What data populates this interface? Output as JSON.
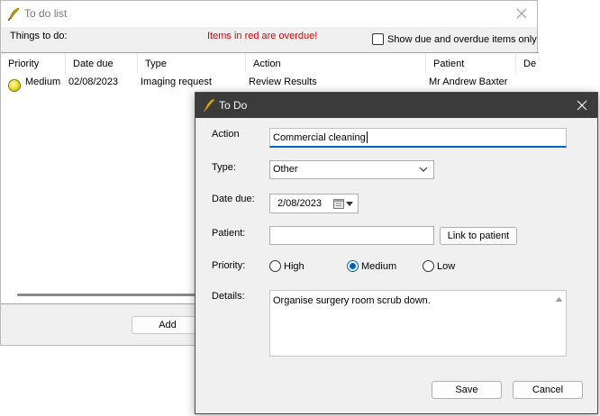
{
  "bg_window": {
    "title": "To do list",
    "things_label": "Things to do:",
    "overdue_note": "Items in red are overdue!",
    "show_due_label": "Show due and overdue items only",
    "columns": [
      "Priority",
      "Date due",
      "Type",
      "Action",
      "Patient",
      "De"
    ],
    "rows": [
      {
        "priority": "Medium",
        "date_due": "02/08/2023",
        "type": "Imaging request",
        "action": "Review Results",
        "patient": "Mr Andrew Baxter"
      }
    ],
    "add_label": "Add"
  },
  "dialog": {
    "title": "To Do",
    "action_label": "Action",
    "action_value": "Commercial cleaning",
    "type_label": "Type:",
    "type_value": "Other",
    "date_label": "Date due:",
    "date_value": "2/08/2023",
    "patient_label": "Patient:",
    "patient_value": "",
    "link_patient_label": "Link to patient",
    "priority_label": "Priority:",
    "priority_options": [
      "High",
      "Medium",
      "Low"
    ],
    "priority_selected": "Medium",
    "details_label": "Details:",
    "details_value": "Organise surgery room scrub down.",
    "save_label": "Save",
    "cancel_label": "Cancel"
  },
  "colors": {
    "overdue_red": "#e00000",
    "focus_blue": "#0067c0",
    "dialog_titlebar": "#3b3b3b",
    "priority_medium": "#f2e23a"
  },
  "icons": {
    "app": "quill-icon",
    "close": "close-icon",
    "priority": "priority-ball-icon",
    "dropdown": "chevron-down-icon",
    "calendar": "calendar-icon"
  }
}
